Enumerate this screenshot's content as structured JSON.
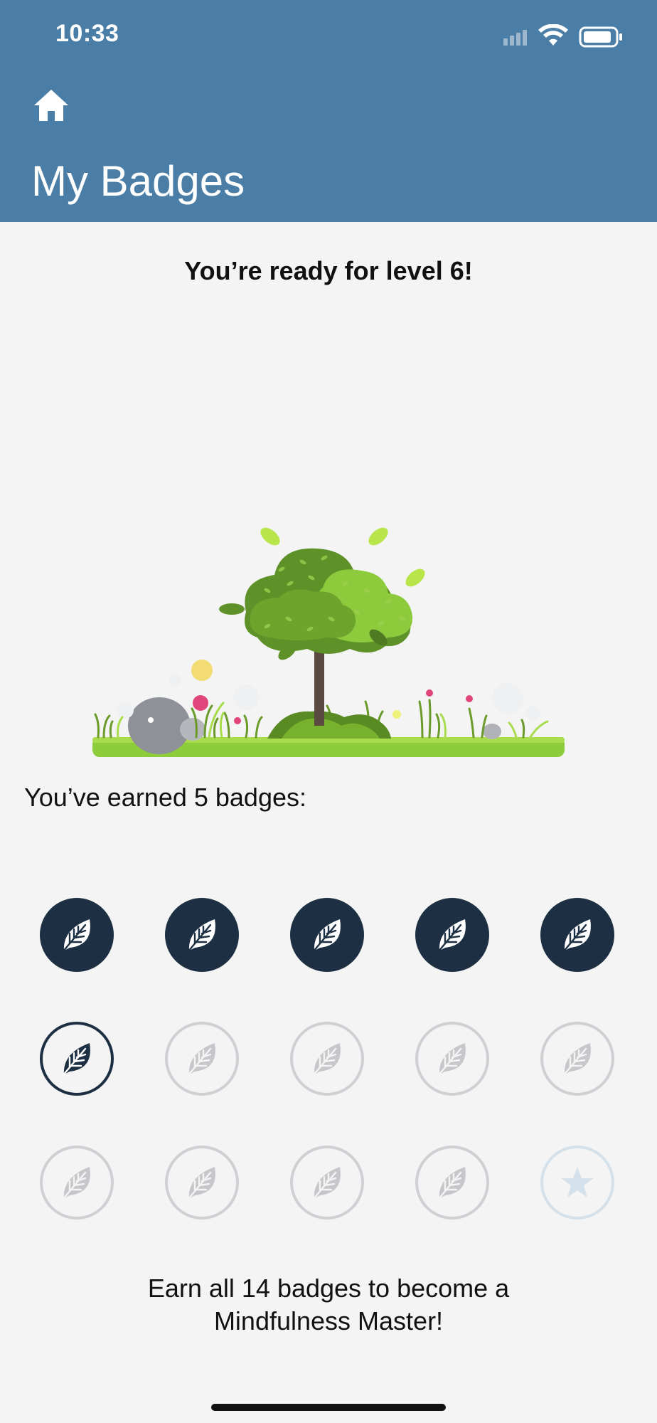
{
  "status_bar": {
    "time": "10:33"
  },
  "header": {
    "title": "My Badges",
    "home_icon": "home-icon"
  },
  "level_message": "You’re ready for level 6!",
  "earned_message": "You’ve earned 5 badges:",
  "footer_message_line1": "Earn all 14 badges to become a",
  "footer_message_line2": "Mindfulness Master!",
  "colors": {
    "header": "#4a7ea6",
    "badge_earned": "#1d2f42",
    "badge_locked": "#cfd0d3",
    "background": "#f4f4f4"
  },
  "badges": [
    {
      "state": "earned",
      "icon": "leaf-icon"
    },
    {
      "state": "earned",
      "icon": "leaf-icon"
    },
    {
      "state": "earned",
      "icon": "leaf-icon"
    },
    {
      "state": "earned",
      "icon": "leaf-icon"
    },
    {
      "state": "earned",
      "icon": "leaf-icon"
    },
    {
      "state": "next",
      "icon": "leaf-icon"
    },
    {
      "state": "locked",
      "icon": "leaf-icon"
    },
    {
      "state": "locked",
      "icon": "leaf-icon"
    },
    {
      "state": "locked",
      "icon": "leaf-icon"
    },
    {
      "state": "locked",
      "icon": "leaf-icon"
    },
    {
      "state": "locked",
      "icon": "leaf-icon"
    },
    {
      "state": "locked",
      "icon": "leaf-icon"
    },
    {
      "state": "locked",
      "icon": "leaf-icon"
    },
    {
      "state": "locked",
      "icon": "leaf-icon"
    },
    {
      "state": "star",
      "icon": "star-icon"
    }
  ]
}
